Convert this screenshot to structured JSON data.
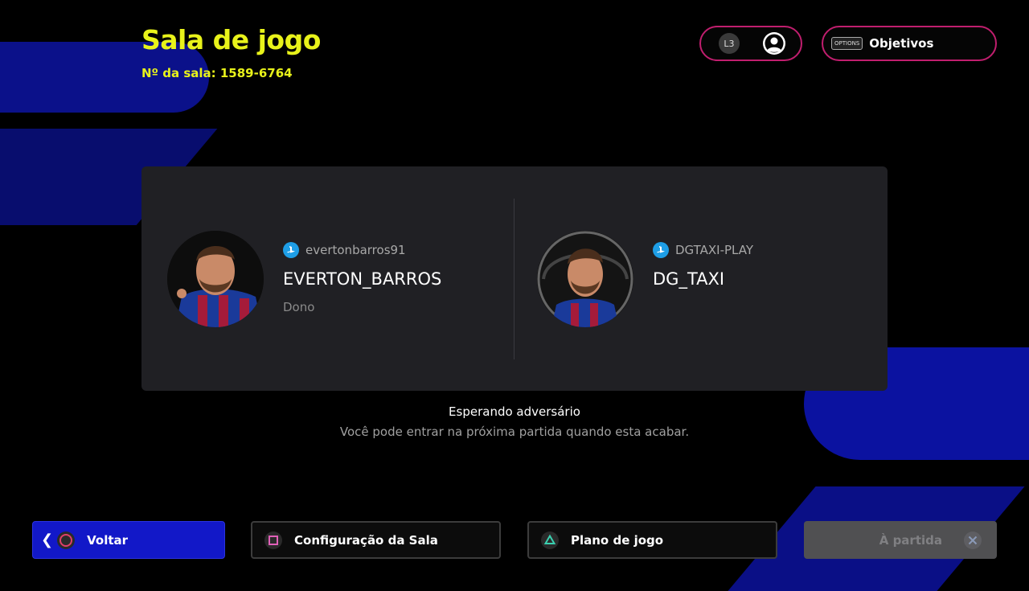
{
  "header": {
    "title": "Sala de jogo",
    "room_number": "Nº da sala: 1589-6764"
  },
  "top_right": {
    "profile_button": {
      "badge": "L3",
      "icon": "user-circle-icon"
    },
    "objectives_button": {
      "options_tag": "OPTIONS",
      "label": "Objetivos"
    }
  },
  "players": [
    {
      "psn_id": "evertonbarros91",
      "name": "EVERTON_BARROS",
      "role": "Dono",
      "icon": "playstation-icon"
    },
    {
      "psn_id": "DGTAXI-PLAY",
      "name": "DG_TAXI",
      "role": "",
      "icon": "playstation-icon"
    }
  ],
  "status": {
    "title": "Esperando adversário",
    "message": "Você pode entrar na próxima partida quando esta acabar."
  },
  "footer": {
    "back_label": "Voltar",
    "config_label": "Configuração da Sala",
    "plan_label": "Plano de jogo",
    "match_label": "À partida"
  },
  "colors": {
    "accent_yellow": "#e8f21a",
    "pill_border": "#c01e6e",
    "back_button": "#1218c8",
    "panel": "#202024",
    "playstation_blue": "#1e9ee6"
  }
}
